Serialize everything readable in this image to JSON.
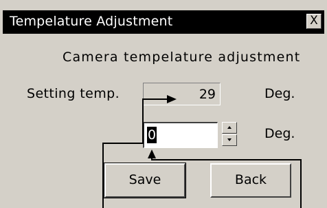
{
  "window": {
    "title": "Tempelature Adjustment",
    "close_label": "X"
  },
  "heading": "Camera tempelature adjustment",
  "setting": {
    "label": "Setting temp.",
    "value": "29",
    "unit": "Deg."
  },
  "input": {
    "value": "0",
    "unit": "Deg."
  },
  "buttons": {
    "save": "Save",
    "back": "Back"
  },
  "colors": {
    "face": "#d4d0c8",
    "titlebar": "#000000"
  }
}
